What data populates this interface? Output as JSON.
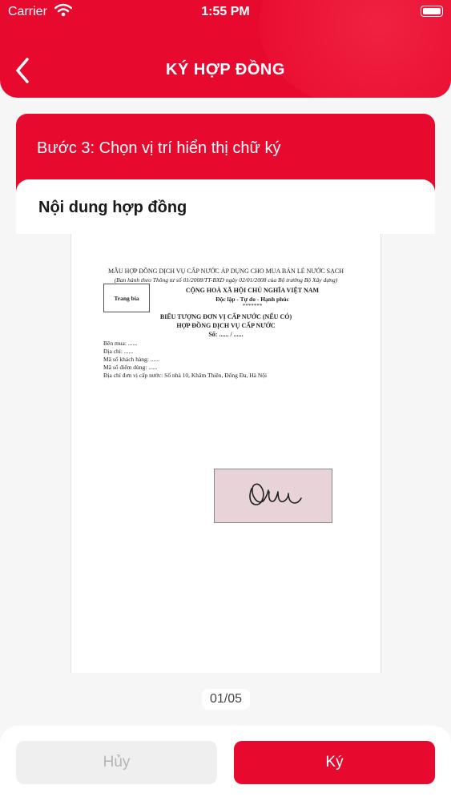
{
  "status_bar": {
    "carrier": "Carrier",
    "time": "1:55 PM"
  },
  "header": {
    "title": "KÝ HỢP ĐỒNG"
  },
  "step": {
    "label": "Bước 3: Chọn vị trí hiển thị chữ ký"
  },
  "content": {
    "label": "Nội dung hợp đồng"
  },
  "document": {
    "line1": "MẪU HỢP ĐỒNG DỊCH VỤ CẤP NƯỚC ÁP DỤNG CHO MUA BÁN LẺ NƯỚC SẠCH",
    "line2": "(Ban hành theo Thông tư số 01/2008/TT-BXD ngày 02/01/2008 của Bộ trưởng Bộ Xây dựng)",
    "cover_label": "Trang bìa",
    "line3": "CỘNG HOÀ XÃ HỘI CHỦ NGHĨA VIỆT NAM",
    "line4": "Độc lập - Tự do - Hạnh phúc",
    "line5": "*******",
    "line6": "BIỂU TƯỢNG ĐƠN VỊ CẤP NƯỚC (NẾU CÓ)",
    "line7": "HỢP ĐỒNG DỊCH VỤ CẤP NƯỚC",
    "line8": "Số: ...... / ......",
    "fields": [
      "Bên mua: ......",
      "Địa chỉ: ......",
      "Mã số khách hàng: ......",
      "Mã số điểm dùng: ......",
      "Địa chỉ đơn vị cấp nước: Số nhà 10, Khâm Thiên, Đống Đa, Hà Nội"
    ]
  },
  "pager": {
    "text": "01/05"
  },
  "buttons": {
    "cancel": "Hủy",
    "sign": "Ký"
  },
  "colors": {
    "brand": "#e8092e",
    "signature_box": "#e8d4d8"
  }
}
